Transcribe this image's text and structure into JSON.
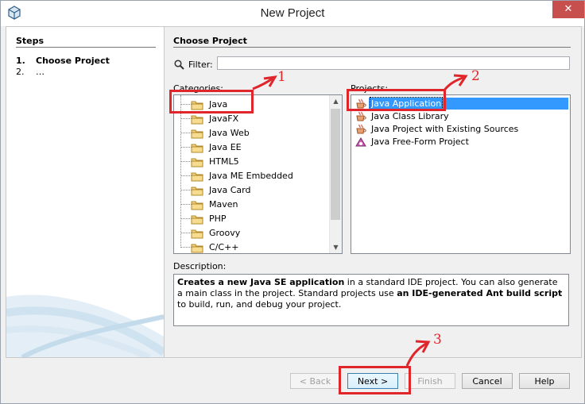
{
  "window": {
    "title": "New Project",
    "close_glyph": "✕"
  },
  "steps": {
    "heading": "Steps",
    "items": [
      {
        "num": "1.",
        "label": "Choose Project"
      },
      {
        "num": "2.",
        "label": "…"
      }
    ]
  },
  "main": {
    "section_title": "Choose Project",
    "filter": {
      "label": "Filter:",
      "value": "",
      "placeholder": ""
    },
    "categories_label": "Categories:",
    "projects_label": "Projects:",
    "categories": [
      "Java",
      "JavaFX",
      "Java Web",
      "Java EE",
      "HTML5",
      "Java ME Embedded",
      "Java Card",
      "Maven",
      "PHP",
      "Groovy",
      "C/C++"
    ],
    "projects": [
      {
        "label": "Java Application",
        "selected": true
      },
      {
        "label": "Java Class Library",
        "selected": false
      },
      {
        "label": "Java Project with Existing Sources",
        "selected": false
      },
      {
        "label": "Java Free-Form Project",
        "selected": false
      }
    ],
    "description_label": "Description:",
    "description": {
      "b1": "Creates a new Java SE application",
      "t1": " in a standard IDE project. You can also generate a main class in the project. Standard projects use ",
      "b2": "an IDE-generated Ant build script",
      "t2": " to build, run, and debug your project."
    }
  },
  "buttons": {
    "back": "< Back",
    "next": "Next >",
    "finish": "Finish",
    "cancel": "Cancel",
    "help": "Help"
  },
  "annotations": [
    "1",
    "2",
    "3"
  ],
  "colors": {
    "annotation": "#e0262b",
    "selection": "#3399ff",
    "close_button": "#c7504e"
  }
}
